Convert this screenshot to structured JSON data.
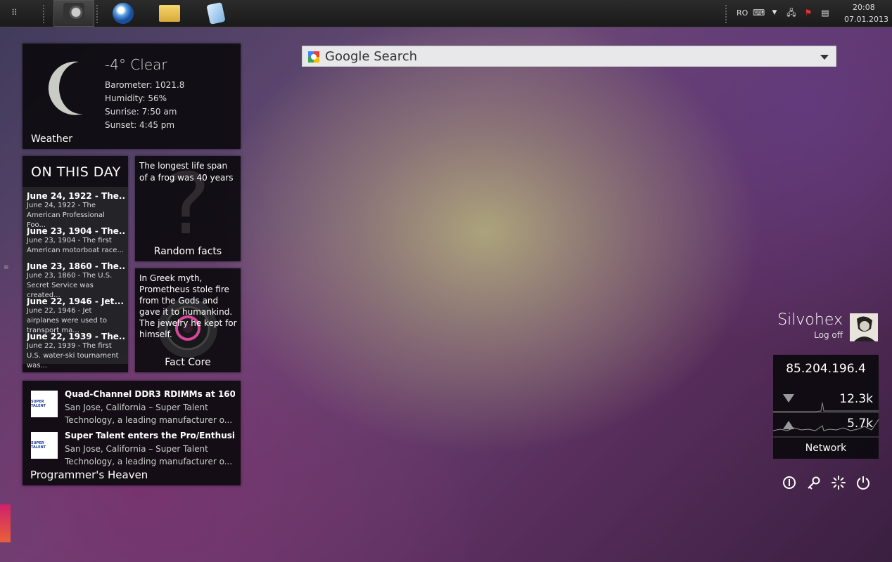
{
  "taskbar": {
    "apps": [
      {
        "name": "Steam",
        "icon": "steam-icon"
      },
      {
        "name": "Browser",
        "icon": "browser-icon"
      },
      {
        "name": "Explorer",
        "icon": "folder-icon"
      },
      {
        "name": "Notes",
        "icon": "notepad-icon"
      }
    ],
    "tray": {
      "lang": "RO",
      "time": "20:08",
      "date": "07.01.2013"
    }
  },
  "weather": {
    "temp": "-4° Clear",
    "barometer": "Barometer: 1021.8",
    "humidity": "Humidity: 56%",
    "sunrise": "Sunrise: 7:50 am",
    "sunset": "Sunset: 4:45 pm",
    "title": "Weather"
  },
  "on_this_day": {
    "title": "ON THIS DAY",
    "items": [
      {
        "head": "June 24, 1922 - The...",
        "desc": "June 24, 1922 - The American Professional Foo..."
      },
      {
        "head": "June 23, 1904 - The...",
        "desc": "June 23, 1904 - The first American motorboat race..."
      },
      {
        "head": "June 23, 1860 - The...",
        "desc": "June 23, 1860 - The U.S. Secret Service was created..."
      },
      {
        "head": "June 22, 1946 - Jet...",
        "desc": "June 22, 1946 - Jet airplanes were used to transport ma..."
      },
      {
        "head": "June 22, 1939 - The...",
        "desc": "June 22, 1939 - The first U.S. water-ski tournament was..."
      }
    ]
  },
  "random_facts": {
    "text": "The longest life span of a frog was 40 years",
    "title": "Random facts"
  },
  "fact_core": {
    "text": "In Greek myth, Prometheus stole fire from the Gods and gave it to humankind. The jewelry he kept for himself.",
    "title": "Fact Core"
  },
  "news": {
    "title": "Programmer's Heaven",
    "items": [
      {
        "logo": "SUPER TALENT",
        "title": "Quad-Channel DDR3 RDIMMs at 160...",
        "desc": "San Jose, California – Super Talent Technology, a leading manufacturer o..."
      },
      {
        "logo": "SUPER TALENT",
        "title": "Super Talent enters the Pro/Enthusia...",
        "desc": "San Jose, California – Super Talent Technology, a leading manufacturer o..."
      }
    ]
  },
  "search": {
    "label": "Google Search"
  },
  "user": {
    "name": "Silvohex",
    "logoff": "Log off"
  },
  "network": {
    "ip": "85.204.196.4",
    "down": "12.3k",
    "up": "5.7k",
    "title": "Network"
  },
  "controls": [
    "info-icon",
    "key-icon",
    "loading-icon",
    "power-icon"
  ]
}
